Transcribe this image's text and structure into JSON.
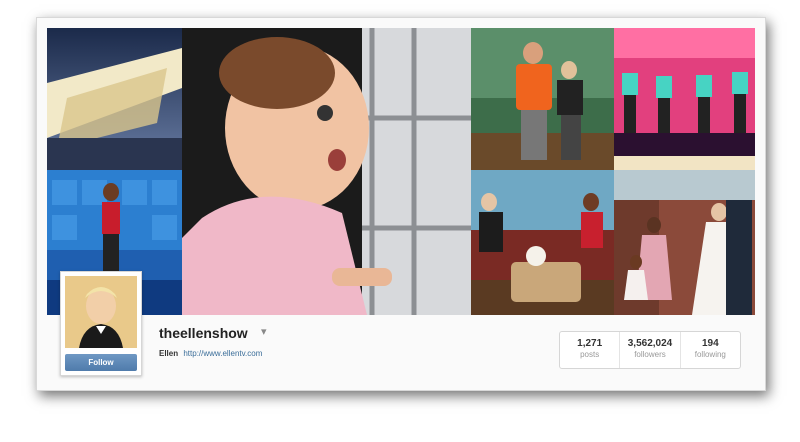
{
  "profile": {
    "username": "theellenshow",
    "dropdown_caret": "▾",
    "full_name": "Ellen",
    "website": "http://www.ellentv.com",
    "follow_label": "Follow"
  },
  "stats": [
    {
      "value": "1,271",
      "label": "posts"
    },
    {
      "value": "3,562,024",
      "label": "followers"
    },
    {
      "value": "194",
      "label": "following"
    }
  ],
  "colors": {
    "accent": "#4f7bab",
    "link": "#3a6d99",
    "stage_pink": "#e2407e",
    "studio_blue": "#2c7fd0"
  }
}
